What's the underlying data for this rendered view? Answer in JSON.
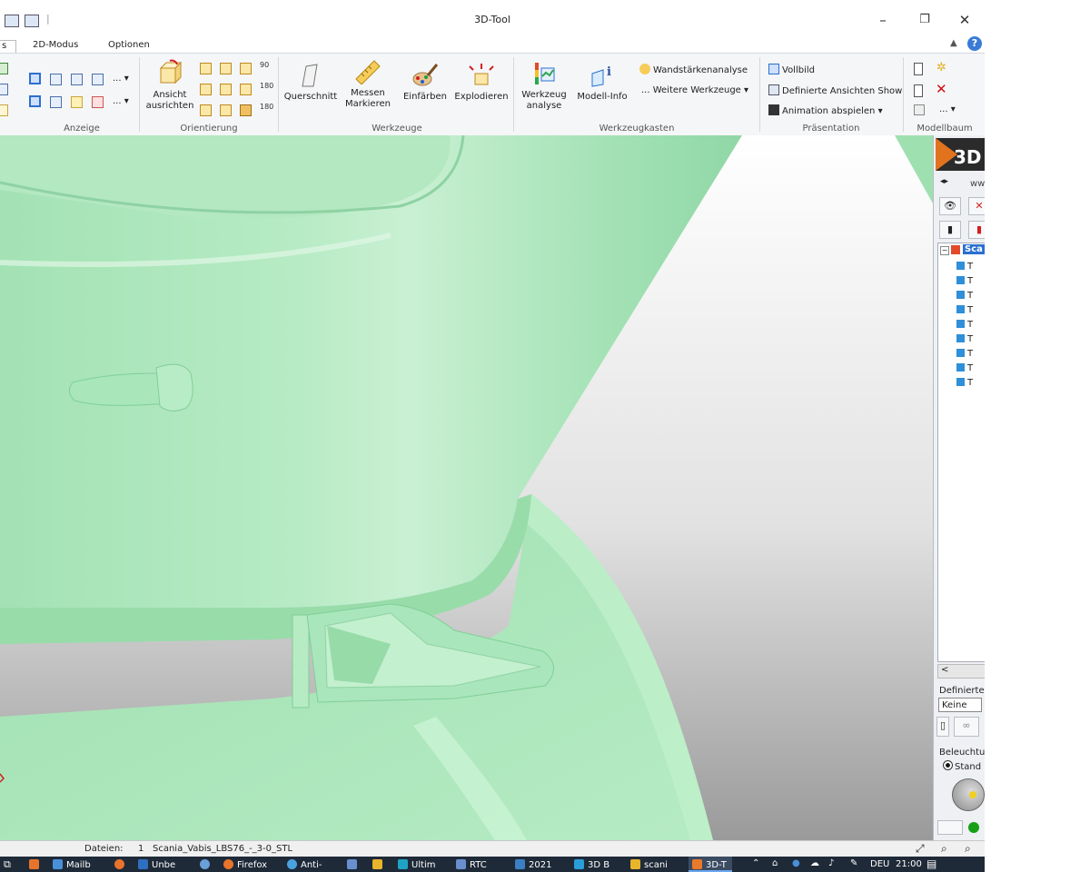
{
  "window": {
    "title": "3D-Tool",
    "minimize": "–",
    "restore": "❐",
    "close": "✕"
  },
  "tabs": [
    {
      "label": "s"
    },
    {
      "label": "2D-Modus"
    },
    {
      "label": "Optionen"
    }
  ],
  "help_label": "?",
  "ribbon": {
    "groups": [
      {
        "label": "Anzeige"
      },
      {
        "label": "Orientierung"
      },
      {
        "label": "Werkzeuge"
      },
      {
        "label": "Werkzeugkasten"
      },
      {
        "label": "Präsentation"
      },
      {
        "label": "Modellbaum"
      }
    ],
    "ansicht_button": {
      "line1": "Ansicht",
      "line2": "ausrichten"
    },
    "tools": [
      {
        "label": "Querschnitt"
      },
      {
        "line1": "Messen",
        "line2": "Markieren"
      },
      {
        "label": "Einfärben"
      },
      {
        "label": "Explodieren"
      }
    ],
    "werkzeug_analyse": {
      "line1": "Werkzeug",
      "line2": "analyse"
    },
    "modell_info": "Modell-Info",
    "wandstaerke": "Wandstärkenanalyse",
    "weitere": "... Weitere Werkzeuge",
    "vollbild": "Vollbild",
    "definierte_show": "Definierte Ansichten Show",
    "animation": "Animation abspielen",
    "more_dropdown": "... ▾",
    "more_dropdown2": "... ▾",
    "more_dropdown3": "... ▾",
    "orient_180a": "180",
    "orient_180b": "180",
    "orient_90": "90"
  },
  "panel": {
    "logo_text": "3D",
    "www": "ww",
    "tree_root": "Sca",
    "tree_items": [
      "T",
      "T",
      "T",
      "T",
      "T",
      "T",
      "T",
      "T",
      "T"
    ],
    "scroll_left": "<",
    "definierte_label": "Definierte",
    "definierte_select": "Keine",
    "beleuchtung_label": "Beleuchtur",
    "standard_option": "Stand"
  },
  "status": {
    "dateien_label": "Dateien:",
    "count": "1",
    "filename": "Scania_Vabis_LBS76_-_3-0_STL"
  },
  "taskbar": {
    "items": [
      {
        "label": "Mailb",
        "color": "#4a90d9"
      },
      {
        "label": "Unbe",
        "color": "#2f6fc1"
      },
      {
        "label": "Firefox",
        "color": "#e8742c"
      },
      {
        "label": "Anti-",
        "color": "#4aa3df"
      },
      {
        "label": "Ultim",
        "color": "#1fa3c4"
      },
      {
        "label": "RTC",
        "color": "#6a8fd0"
      },
      {
        "label": "2021",
        "color": "#3b7fc4"
      },
      {
        "label": "3D B",
        "color": "#2a9ed8"
      },
      {
        "label": "scani",
        "color": "#e8b42c"
      },
      {
        "label": "3D-T",
        "color": "#e77a2b"
      }
    ],
    "lang": "DEU",
    "time": "21:00"
  },
  "colors": {
    "model_green": "#a6e3b7",
    "model_dark": "#7fcf97",
    "background_grey": "#d0d0d0",
    "accent_blue": "#3a7bd5"
  }
}
